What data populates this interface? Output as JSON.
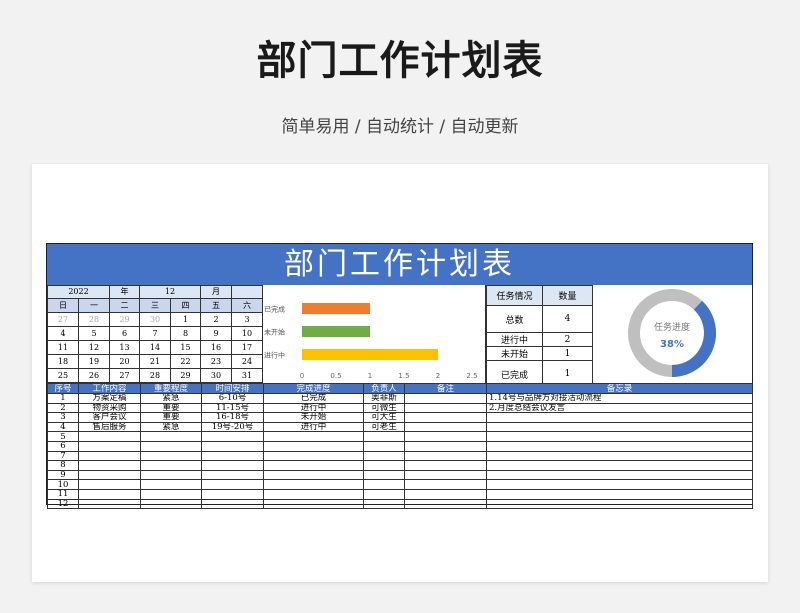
{
  "page": {
    "title": "部门工作计划表",
    "subtitle": "简单易用 / 自动统计 / 自动更新"
  },
  "sheet": {
    "title": "部门工作计划表",
    "calendar": {
      "year": "2022",
      "year_label": "年",
      "month": "12",
      "month_label": "月",
      "weekdays": [
        "日",
        "一",
        "二",
        "三",
        "四",
        "五",
        "六"
      ],
      "weeks": [
        [
          "27",
          "28",
          "29",
          "30",
          "1",
          "2",
          "3"
        ],
        [
          "4",
          "5",
          "6",
          "7",
          "8",
          "9",
          "10"
        ],
        [
          "11",
          "12",
          "13",
          "14",
          "15",
          "16",
          "17"
        ],
        [
          "18",
          "19",
          "20",
          "21",
          "22",
          "23",
          "24"
        ],
        [
          "25",
          "26",
          "27",
          "28",
          "29",
          "30",
          "31"
        ]
      ]
    },
    "summary": {
      "headers": [
        "任务情况",
        "数量"
      ],
      "rows": [
        {
          "label": "总数",
          "value": "4"
        },
        {
          "label": "进行中",
          "value": "2"
        },
        {
          "label": "未开始",
          "value": "1"
        },
        {
          "label": "已完成",
          "value": "1"
        }
      ]
    },
    "donut": {
      "label": "任务进度",
      "percent_text": "38%",
      "value": 0.38,
      "fill_color": "#4472c4",
      "track_color": "#bfbfbf"
    },
    "table": {
      "headers": [
        "序号",
        "工作内容",
        "重要程度",
        "时间安排",
        "完成进度",
        "负责人",
        "备注",
        "备忘录"
      ],
      "rows": [
        {
          "no": "1",
          "task": "方案定稿",
          "priority": "紧急",
          "time": "6-10号",
          "progress": "已完成",
          "owner": "奥菲斯",
          "note": "",
          "memo": "1.14号与品牌方对接活动流程"
        },
        {
          "no": "2",
          "task": "物资采购",
          "priority": "重要",
          "time": "11-15号",
          "progress": "进行中",
          "owner": "可微生",
          "note": "",
          "memo": "2.月度总结会议发言"
        },
        {
          "no": "3",
          "task": "客户会议",
          "priority": "重要",
          "time": "16-18号",
          "progress": "未开始",
          "owner": "可大生",
          "note": "",
          "memo": ""
        },
        {
          "no": "4",
          "task": "售后服务",
          "priority": "紧急",
          "time": "19号-20号",
          "progress": "进行中",
          "owner": "可老生",
          "note": "",
          "memo": ""
        },
        {
          "no": "5",
          "task": "",
          "priority": "",
          "time": "",
          "progress": "",
          "owner": "",
          "note": "",
          "memo": ""
        },
        {
          "no": "6",
          "task": "",
          "priority": "",
          "time": "",
          "progress": "",
          "owner": "",
          "note": "",
          "memo": ""
        },
        {
          "no": "7",
          "task": "",
          "priority": "",
          "time": "",
          "progress": "",
          "owner": "",
          "note": "",
          "memo": ""
        },
        {
          "no": "8",
          "task": "",
          "priority": "",
          "time": "",
          "progress": "",
          "owner": "",
          "note": "",
          "memo": ""
        },
        {
          "no": "9",
          "task": "",
          "priority": "",
          "time": "",
          "progress": "",
          "owner": "",
          "note": "",
          "memo": ""
        },
        {
          "no": "10",
          "task": "",
          "priority": "",
          "time": "",
          "progress": "",
          "owner": "",
          "note": "",
          "memo": ""
        },
        {
          "no": "11",
          "task": "",
          "priority": "",
          "time": "",
          "progress": "",
          "owner": "",
          "note": "",
          "memo": ""
        },
        {
          "no": "12",
          "task": "",
          "priority": "",
          "time": "",
          "progress": "",
          "owner": "",
          "note": "",
          "memo": ""
        }
      ]
    }
  },
  "chart_data": {
    "type": "bar",
    "orientation": "horizontal",
    "categories": [
      "已完成",
      "未开始",
      "进行中"
    ],
    "values": [
      1,
      1,
      2
    ],
    "colors": [
      "#ed7d31",
      "#70ad47",
      "#ffc000"
    ],
    "xlim": [
      0,
      2.5
    ],
    "xticks": [
      "0",
      "0.5",
      "1",
      "1.5",
      "2",
      "2.5"
    ],
    "grid": false,
    "legend": "none"
  }
}
